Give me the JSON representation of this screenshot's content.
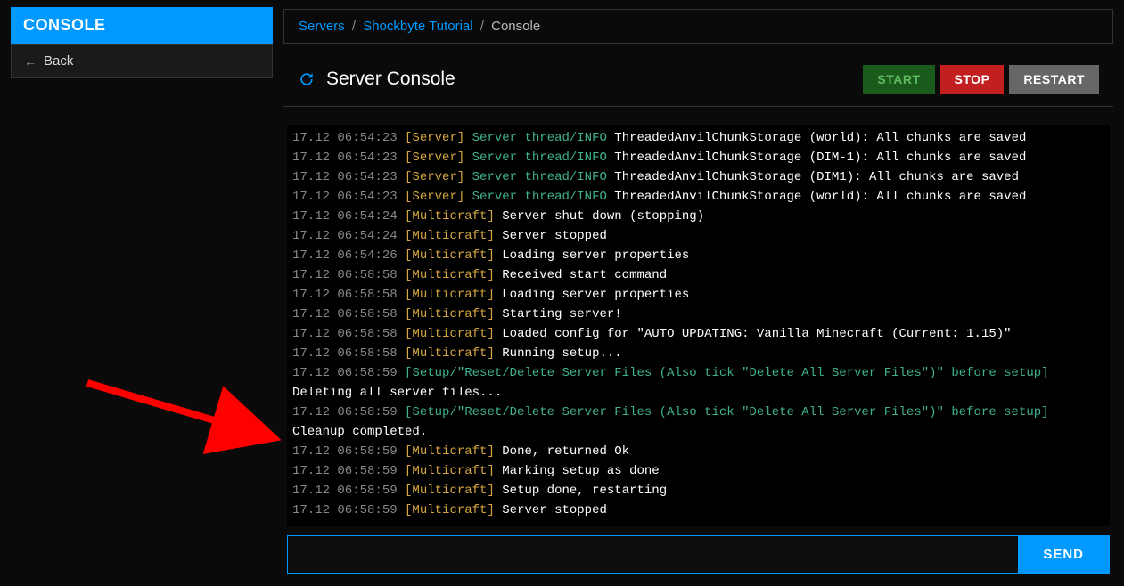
{
  "sidebar": {
    "title": "CONSOLE",
    "back_label": "Back"
  },
  "breadcrumb": {
    "servers": "Servers",
    "server_name": "Shockbyte Tutorial",
    "current": "Console"
  },
  "header": {
    "title": "Server Console",
    "start_label": "START",
    "stop_label": "STOP",
    "restart_label": "RESTART"
  },
  "console_lines": [
    {
      "ts": "17.12 06:54:23",
      "level": "[Server]",
      "thread": "Server thread/INFO",
      "msg": "ThreadedAnvilChunkStorage (world): All chunks are saved",
      "cls": "lvl-server"
    },
    {
      "ts": "17.12 06:54:23",
      "level": "[Server]",
      "thread": "Server thread/INFO",
      "msg": "ThreadedAnvilChunkStorage (DIM-1): All chunks are saved",
      "cls": "lvl-server"
    },
    {
      "ts": "17.12 06:54:23",
      "level": "[Server]",
      "thread": "Server thread/INFO",
      "msg": "ThreadedAnvilChunkStorage (DIM1): All chunks are saved",
      "cls": "lvl-server"
    },
    {
      "ts": "17.12 06:54:23",
      "level": "[Server]",
      "thread": "Server thread/INFO",
      "msg": "ThreadedAnvilChunkStorage (world): All chunks are saved",
      "cls": "lvl-server"
    },
    {
      "ts": "17.12 06:54:24",
      "level": "[Multicraft]",
      "thread": "",
      "msg": "Server shut down (stopping)",
      "cls": "lvl-multicraft"
    },
    {
      "ts": "17.12 06:54:24",
      "level": "[Multicraft]",
      "thread": "",
      "msg": "Server stopped",
      "cls": "lvl-multicraft"
    },
    {
      "ts": "17.12 06:54:26",
      "level": "[Multicraft]",
      "thread": "",
      "msg": "Loading server properties",
      "cls": "lvl-multicraft"
    },
    {
      "ts": "17.12 06:58:58",
      "level": "[Multicraft]",
      "thread": "",
      "msg": "Received start command",
      "cls": "lvl-multicraft"
    },
    {
      "ts": "17.12 06:58:58",
      "level": "[Multicraft]",
      "thread": "",
      "msg": "Loading server properties",
      "cls": "lvl-multicraft"
    },
    {
      "ts": "17.12 06:58:58",
      "level": "[Multicraft]",
      "thread": "",
      "msg": "Starting server!",
      "cls": "lvl-multicraft"
    },
    {
      "ts": "17.12 06:58:58",
      "level": "[Multicraft]",
      "thread": "",
      "msg": "Loaded config for \"AUTO UPDATING: Vanilla Minecraft (Current: 1.15)\"",
      "cls": "lvl-multicraft"
    },
    {
      "ts": "17.12 06:58:58",
      "level": "[Multicraft]",
      "thread": "",
      "msg": "Running setup...",
      "cls": "lvl-multicraft"
    },
    {
      "ts": "17.12 06:58:59",
      "level": "[Setup/\"Reset/Delete Server Files (Also tick \"Delete All Server Files\")\" before setup]",
      "thread": "",
      "msg": "Deleting all server files...",
      "cls": "lvl-setup",
      "wrap": true
    },
    {
      "ts": "17.12 06:58:59",
      "level": "[Setup/\"Reset/Delete Server Files (Also tick \"Delete All Server Files\")\" before setup]",
      "thread": "",
      "msg": "Cleanup completed.",
      "cls": "lvl-setup",
      "wrap": true
    },
    {
      "ts": "17.12 06:58:59",
      "level": "[Multicraft]",
      "thread": "",
      "msg": "Done, returned Ok",
      "cls": "lvl-multicraft"
    },
    {
      "ts": "17.12 06:58:59",
      "level": "[Multicraft]",
      "thread": "",
      "msg": "Marking setup as done",
      "cls": "lvl-multicraft"
    },
    {
      "ts": "17.12 06:58:59",
      "level": "[Multicraft]",
      "thread": "",
      "msg": "Setup done, restarting",
      "cls": "lvl-multicraft"
    },
    {
      "ts": "17.12 06:58:59",
      "level": "[Multicraft]",
      "thread": "",
      "msg": "Server stopped",
      "cls": "lvl-multicraft"
    }
  ],
  "command": {
    "value": "",
    "send_label": "SEND"
  }
}
